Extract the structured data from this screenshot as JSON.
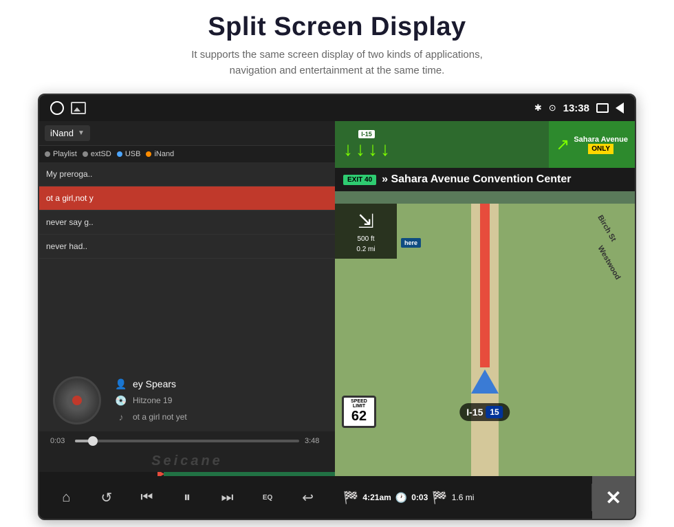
{
  "page": {
    "title": "Split Screen Display",
    "subtitle_line1": "It supports the same screen display of two kinds of applications,",
    "subtitle_line2": "navigation and entertainment at the same time."
  },
  "statusbar": {
    "time": "13:38"
  },
  "sources": {
    "dropdown_label": "iNand",
    "tabs": [
      {
        "label": "Playlist",
        "dot": "gray"
      },
      {
        "label": "extSD",
        "dot": "gray"
      },
      {
        "label": "USB",
        "dot": "blue"
      },
      {
        "label": "iNand",
        "dot": "orange"
      }
    ]
  },
  "playlist": {
    "items": [
      {
        "label": "My preroga..",
        "active": false,
        "red": false
      },
      {
        "label": "ot a girl,not y",
        "active": false,
        "red": true
      },
      {
        "label": "never say g..",
        "active": false,
        "red": false
      },
      {
        "label": "never had..",
        "active": false,
        "red": false
      }
    ]
  },
  "player": {
    "artist": "ey Spears",
    "album": "Hitzone 19",
    "song": "ot a girl not yet",
    "time_current": "0:03",
    "time_total": "3:48",
    "progress_pct": 8
  },
  "watermark": "Seicane",
  "controls": {
    "home": "⌂",
    "repeat": "↺",
    "prev": "⏮",
    "pause": "⏸",
    "next": "⏭",
    "eq": "EQ",
    "back": "↩"
  },
  "navigation": {
    "highway": "I-15",
    "exit_number": "EXIT 40",
    "direction": "» Sahara Avenue Convention Center",
    "street1": "Sahara Avenue",
    "street2": "Birch St",
    "street3": "Westwood",
    "speed_limit": "62",
    "interstate_label": "I-15",
    "interstate_num": "15",
    "turn_distance": "500 ft",
    "turn_distance2": "0.2 mi",
    "trip_arrival": "4:21am",
    "trip_duration": "0:03",
    "trip_distance": "1.6 mi",
    "only_label": "ONLY"
  }
}
